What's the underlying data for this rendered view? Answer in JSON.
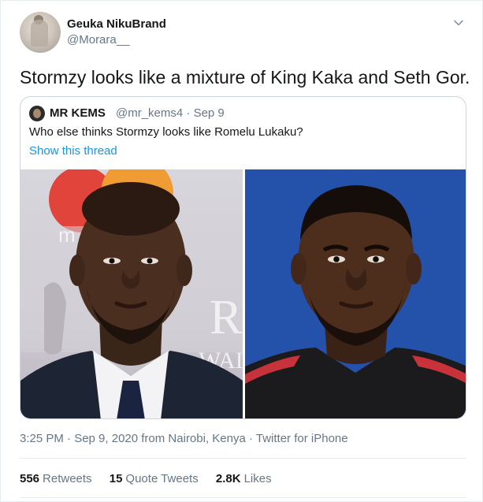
{
  "author": {
    "display_name": "Geuka NikuBrand",
    "handle": "@Morara__"
  },
  "tweet_text": "Stormzy looks like a mixture of King Kaka and Seth Gor.",
  "quoted_tweet": {
    "display_name": "MR KEMS",
    "handle_date": "@mr_kems4 · Sep 9",
    "text": "Who else thinks Stormzy looks like Romelu Lukaku?",
    "show_thread": "Show this thread"
  },
  "meta": "3:25 PM · Sep 9, 2020 from Nairobi, Kenya · Twitter for iPhone",
  "stats": {
    "retweets_count": "556",
    "retweets_label": "Retweets",
    "quotes_count": "15",
    "quotes_label": "Quote Tweets",
    "likes_count": "2.8K",
    "likes_label": "Likes"
  },
  "image_lettering": {
    "left_logo_fragment": "m",
    "left_backdrop_letters": "R",
    "left_backdrop_letters_2": "WAI"
  },
  "colors": {
    "link": "#1b95e0",
    "secondary_text": "#657786",
    "border": "#ccd6dd"
  },
  "icons": [
    "chevron-down-icon"
  ]
}
